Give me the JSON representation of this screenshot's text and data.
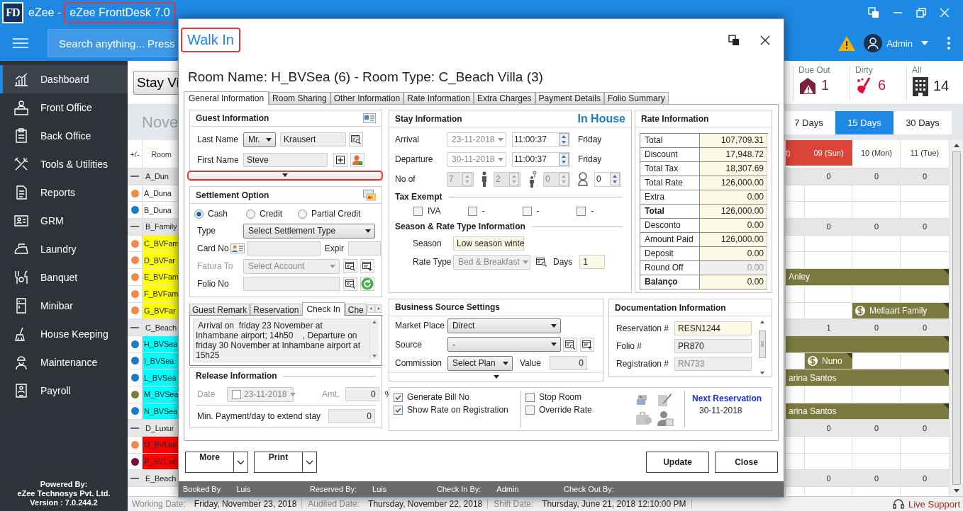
{
  "app": {
    "logo": "FD",
    "title_prefix": "eZee -",
    "title": "eZee FrontDesk 7.0",
    "title_highlighted": true
  },
  "search": {
    "placeholder": "Search anything... Press"
  },
  "user": {
    "name": "Admin"
  },
  "sidebar": {
    "items": [
      {
        "label": "Dashboard",
        "selected": true
      },
      {
        "label": "Front Office",
        "selected": false
      },
      {
        "label": "Back Office",
        "selected": false
      },
      {
        "label": "Tools & Utilities",
        "selected": false
      },
      {
        "label": "Reports",
        "selected": false
      },
      {
        "label": "GRM",
        "selected": false
      },
      {
        "label": "Laundry",
        "selected": false
      },
      {
        "label": "Banquet",
        "selected": false
      },
      {
        "label": "Minibar",
        "selected": false
      },
      {
        "label": "House Keeping",
        "selected": false
      },
      {
        "label": "Maintenance",
        "selected": false
      },
      {
        "label": "Payroll",
        "selected": false
      }
    ],
    "footer": [
      "Powered By:",
      "eZee Technosys Pvt. Ltd.",
      "Version : 7.0.244.2"
    ]
  },
  "board": {
    "view_button": "Stay Vi",
    "month": "Nove",
    "stats": [
      {
        "label": "Due Out",
        "count": "1"
      },
      {
        "label": "Dirty",
        "count": "6"
      },
      {
        "label": "All",
        "count": "14"
      }
    ],
    "ranges": [
      {
        "label": "7 Days",
        "selected": false
      },
      {
        "label": "15 Days",
        "selected": true
      },
      {
        "label": "30 Days",
        "selected": false
      }
    ],
    "columns": [
      "+/-",
      "Room"
    ],
    "days": [
      {
        "label": "t)",
        "weekend": true
      },
      {
        "label": "09 (Sun)",
        "weekend": true
      },
      {
        "label": "10 (Mon)",
        "weekend": false
      },
      {
        "label": "11 (Tue)",
        "weekend": false
      }
    ],
    "rows": [
      {
        "kind": "group",
        "room": "A_Dun",
        "cells": [
          {
            "kind": "empty"
          },
          {
            "kind": "count",
            "text": "0"
          },
          {
            "kind": "count",
            "text": "0"
          },
          {
            "kind": "count",
            "text": "0"
          }
        ]
      },
      {
        "kind": "room",
        "room": "A_Duna",
        "color": "#f4874b",
        "cells": [
          {
            "kind": "empty"
          },
          {
            "kind": "empty"
          },
          {
            "kind": "empty"
          },
          {
            "kind": "empty"
          }
        ]
      },
      {
        "kind": "room",
        "room": "B_Duna",
        "color": "#1a7cc4",
        "cells": [
          {
            "kind": "empty"
          },
          {
            "kind": "empty"
          },
          {
            "kind": "empty"
          },
          {
            "kind": "empty"
          }
        ]
      },
      {
        "kind": "group",
        "room": "B_Family",
        "cells": [
          {
            "kind": "empty"
          },
          {
            "kind": "count",
            "text": "0"
          },
          {
            "kind": "count",
            "text": "0"
          },
          {
            "kind": "count",
            "text": "0"
          }
        ]
      },
      {
        "kind": "room",
        "room": "C_BVFam",
        "color": "#f4874b",
        "highlight": {
          "color": "#ffff00"
        },
        "cells": [
          {
            "kind": "empty"
          },
          {
            "kind": "empty"
          },
          {
            "kind": "empty"
          },
          {
            "kind": "empty"
          }
        ]
      },
      {
        "kind": "room",
        "room": "D_BVFar",
        "color": "#f4874b",
        "highlight": {
          "color": "#ffff00"
        },
        "cells": [
          {
            "kind": "empty"
          },
          {
            "kind": "empty"
          },
          {
            "kind": "empty"
          },
          {
            "kind": "empty"
          }
        ]
      },
      {
        "kind": "room",
        "room": "E_BVFam",
        "color": "#f4874b",
        "highlight": {
          "color": "#ffff00"
        },
        "cells": [
          {
            "kind": "booking",
            "guest": "Anley",
            "paid": false
          },
          {
            "kind": "booking_cont"
          },
          {
            "kind": "booking_cont"
          },
          {
            "kind": "booking_cont"
          }
        ]
      },
      {
        "kind": "room",
        "room": "F_BVFam",
        "color": "#f4874b",
        "highlight": {
          "color": "#ffff00"
        },
        "cells": [
          {
            "kind": "empty"
          },
          {
            "kind": "empty"
          },
          {
            "kind": "empty"
          },
          {
            "kind": "empty"
          }
        ]
      },
      {
        "kind": "room",
        "room": "G_BVFar",
        "color": "#f4874b",
        "highlight": {
          "color": "#ffff00"
        },
        "cells": [
          {
            "kind": "empty"
          },
          {
            "kind": "empty"
          },
          {
            "kind": "booking",
            "guest": "Mellaart Family",
            "paid": true
          },
          {
            "kind": "booking_cont"
          }
        ]
      },
      {
        "kind": "group",
        "room": "C_Beach",
        "cells": [
          {
            "kind": "empty"
          },
          {
            "kind": "count",
            "text": "1"
          },
          {
            "kind": "count",
            "text": "0"
          },
          {
            "kind": "count",
            "text": "0"
          }
        ]
      },
      {
        "kind": "room",
        "room": "H_BVSea",
        "color": "#1a7cc4",
        "highlight": {
          "color": "#00ffff"
        },
        "cells": [
          {
            "kind": "booking",
            "paid": false
          },
          {
            "kind": "booking_cont"
          },
          {
            "kind": "booking_cont"
          },
          {
            "kind": "booking_cont"
          }
        ]
      },
      {
        "kind": "room",
        "room": "I_BVSea",
        "color": "#1a7cc4",
        "highlight": {
          "color": "#00ffff"
        },
        "cells": [
          {
            "kind": "empty"
          },
          {
            "kind": "booking",
            "guest": "Nuno",
            "paid": true
          },
          {
            "kind": "empty"
          },
          {
            "kind": "empty"
          }
        ]
      },
      {
        "kind": "room",
        "room": "L_BVSea",
        "color": "#1a7cc4",
        "highlight": {
          "color": "#00ffff"
        },
        "cells": [
          {
            "kind": "booking",
            "guest": "arina Santos",
            "paid": false
          },
          {
            "kind": "booking_cont"
          },
          {
            "kind": "booking_cont"
          },
          {
            "kind": "booking_cont"
          }
        ]
      },
      {
        "kind": "room",
        "room": "M_BVSea",
        "color": "#7d7d3a",
        "highlight": {
          "color": "#00ffff"
        },
        "cells": [
          {
            "kind": "empty"
          },
          {
            "kind": "empty"
          },
          {
            "kind": "empty"
          },
          {
            "kind": "empty"
          }
        ]
      },
      {
        "kind": "room",
        "room": "N_BVSea",
        "color": "#1a7cc4",
        "highlight": {
          "color": "#00ffff"
        },
        "cells": [
          {
            "kind": "booking",
            "guest": "arina Santos",
            "paid": false
          },
          {
            "kind": "booking_cont"
          },
          {
            "kind": "booking_cont"
          },
          {
            "kind": "booking_cont"
          }
        ]
      },
      {
        "kind": "group",
        "room": "D_Luxur",
        "cells": [
          {
            "kind": "empty"
          },
          {
            "kind": "count",
            "text": "0"
          },
          {
            "kind": "count",
            "text": "0"
          },
          {
            "kind": "count",
            "text": "0"
          }
        ]
      },
      {
        "kind": "room",
        "room": "O_BVLux",
        "color": "#f4874b",
        "highlight": {
          "color": "#ff0000"
        },
        "cells": [
          {
            "kind": "empty"
          },
          {
            "kind": "empty"
          },
          {
            "kind": "empty"
          },
          {
            "kind": "empty"
          }
        ]
      },
      {
        "kind": "room",
        "room": "P_BVLux",
        "color": "#7a0f3d",
        "highlight": {
          "color": "#ff0000"
        },
        "cells": [
          {
            "kind": "empty"
          },
          {
            "kind": "empty"
          },
          {
            "kind": "empty"
          },
          {
            "kind": "empty"
          }
        ]
      },
      {
        "kind": "group",
        "room": "E_Beach",
        "cells": [
          {
            "kind": "empty"
          },
          {
            "kind": "count",
            "text": "0"
          },
          {
            "kind": "count",
            "text": "0"
          },
          {
            "kind": "count",
            "text": "0"
          }
        ]
      }
    ]
  },
  "dialog": {
    "title": "Walk In",
    "title_highlighted": true,
    "heading": "Room Name: H_BVSea (6) - Room Type: C_Beach Villa (3)",
    "tabs": [
      {
        "label": "General Information",
        "selected": true
      },
      {
        "label": "Room Sharing",
        "selected": false
      },
      {
        "label": "Other Information",
        "selected": false
      },
      {
        "label": "Rate Information",
        "selected": false
      },
      {
        "label": "Extra Charges",
        "selected": false
      },
      {
        "label": "Payment Details",
        "selected": false
      },
      {
        "label": "Folio Summary",
        "selected": false
      }
    ],
    "guest": {
      "title": "Guest Information",
      "last_label": "Last Name",
      "salutation": "Mr.",
      "last_name": "Krausert",
      "first_label": "First Name",
      "first_name": "Steve",
      "expander_highlighted": true
    },
    "settlement": {
      "title": "Settlement Option",
      "modes": [
        {
          "label": "Cash",
          "selected": true
        },
        {
          "label": "Credit",
          "selected": false
        },
        {
          "label": "Partial Credit",
          "selected": false
        }
      ],
      "type_label": "Type",
      "type": "Select Settlement Type",
      "card_label": "Card No",
      "expiry_label": "Expir",
      "account_label": "Fatura To",
      "account": "Select Account",
      "folio_label": "Folio No"
    },
    "remarks": {
      "tabs": [
        {
          "label": "Guest Remark",
          "selected": false
        },
        {
          "label": "Reservation",
          "selected": false
        },
        {
          "label": "Check In",
          "selected": true
        },
        {
          "label": "Che",
          "selected": false
        }
      ],
      "text": " Arrival on  friday 23 November at Inhambane airport; 14h50    , Departure on friday 30 November at Inhambane airport at 15h25"
    },
    "release": {
      "title": "Release Information",
      "date_label": "Date",
      "date": "23-11-2018",
      "date_checked": false,
      "amount_label": "Amt.",
      "amount": "0",
      "unit": "%",
      "min_label": "Min. Payment/day to extend stay",
      "min_value": "0"
    },
    "stay": {
      "title": "Stay Information",
      "status": "In House",
      "dates": [
        {
          "label": "Arrival",
          "date": "23-11-2018",
          "time": "11:00:37",
          "day": "Friday"
        },
        {
          "label": "Departure",
          "date": "30-11-2018",
          "time": "11:00:37",
          "day": "Friday"
        }
      ],
      "counts_label": "No of",
      "counts": [
        {
          "value": "7",
          "disabled": true
        },
        {
          "value": "2",
          "disabled": true
        },
        {
          "value": "0",
          "disabled": true
        },
        {
          "value": "0",
          "disabled": false
        }
      ],
      "tax_title": "Tax Exempt",
      "taxes": [
        {
          "label": "IVA",
          "checked": false
        },
        {
          "label": "-",
          "checked": false
        },
        {
          "label": "-",
          "checked": false
        },
        {
          "label": "-",
          "checked": false
        }
      ],
      "season_title": "Season & Rate Type Information",
      "season_label": "Season",
      "season": "Low season winte",
      "rate_type_label": "Rate Type",
      "rate_type": "Bed & Breakfast",
      "days_label": "Days",
      "days": "1"
    },
    "rates": {
      "title": "Rate Information",
      "rows": [
        {
          "label": "Total",
          "value": "107,709.31",
          "bold": false,
          "disabled": false
        },
        {
          "label": "Discount",
          "value": "17,948.72",
          "bold": false,
          "disabled": false
        },
        {
          "label": "Total Tax",
          "value": "18,307.69",
          "bold": false,
          "disabled": false
        },
        {
          "label": "Total Rate",
          "value": "126,000.00",
          "bold": false,
          "disabled": false
        },
        {
          "label": "Extra",
          "value": "0.00",
          "bold": false,
          "disabled": false
        },
        {
          "label": "Total",
          "value": "126,000.00",
          "bold": true,
          "disabled": false
        },
        {
          "label": "Desconto",
          "value": "0.00",
          "bold": false,
          "disabled": false
        },
        {
          "label": "Amount Paid",
          "value": "126,000.00",
          "bold": false,
          "disabled": false
        },
        {
          "label": "Deposit",
          "value": "0.00",
          "bold": false,
          "disabled": false
        },
        {
          "label": "Round Off",
          "value": "0.00",
          "bold": false,
          "disabled": true
        },
        {
          "label": "Balanço",
          "value": "0.00",
          "bold": true,
          "disabled": false
        }
      ]
    },
    "business": {
      "title": "Business Source Settings",
      "market_label": "Market Place",
      "market": "Direct",
      "source_label": "Source",
      "source": "-",
      "commission_label": "Commission",
      "commission": "Select Plan",
      "value_label": "Value",
      "value": "0"
    },
    "documentation": {
      "title": "Documentation Information",
      "fields": [
        {
          "label": "Reservation #",
          "value": "RESN1244",
          "kind": "highlighted"
        },
        {
          "label": "Folio #",
          "value": "PR870",
          "kind": "normal"
        },
        {
          "label": "Registration #",
          "value": "RN733",
          "kind": "disabled"
        }
      ]
    },
    "options": [
      {
        "label": "Generate Bill No",
        "checked": true
      },
      {
        "label": "Show Rate on Registration",
        "checked": true
      },
      {
        "label": "Stop Room",
        "checked": false
      },
      {
        "label": "Override Rate",
        "checked": false
      }
    ],
    "next": {
      "title": "Next Reservation",
      "date": "30-11-2018"
    },
    "left_buttons": [
      "More",
      "Print"
    ],
    "right_buttons": [
      "Update",
      "Close"
    ],
    "footer": [
      {
        "label": "Booked By",
        "value": "Luis"
      },
      {
        "label": "Reserved By:",
        "value": "Luis"
      },
      {
        "label": "Check In By:",
        "value": "Admin"
      },
      {
        "label": "Check Out By:"
      }
    ]
  },
  "status_bar": {
    "items": [
      {
        "label": "Working Date:",
        "value": "Friday, November 23, 2018"
      },
      {
        "label": "Audited Date:",
        "value": "Thursday, November 22, 2018"
      },
      {
        "label": "Shift Date:",
        "value": "Thursday, June 21, 2018 12:10:00 PM"
      }
    ],
    "live_support": "Live Support"
  }
}
